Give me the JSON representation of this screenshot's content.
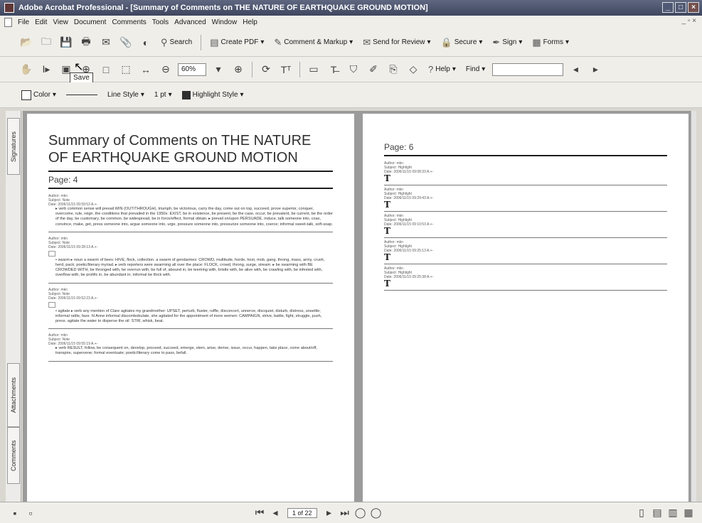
{
  "window": {
    "title": "Adobe Acrobat Professional - [Summary of Comments on THE NATURE OF EARTHQUAKE GROUND MOTION]",
    "minimize": "_",
    "maximize": "□",
    "close": "×"
  },
  "menu": {
    "items": [
      "File",
      "Edit",
      "View",
      "Document",
      "Comments",
      "Tools",
      "Advanced",
      "Window",
      "Help"
    ],
    "mdi_controls": "_ ▫ ×"
  },
  "toolbar1": {
    "search_label": "Search",
    "create_pdf_label": "Create PDF",
    "comment_markup_label": "Comment & Markup",
    "send_review_label": "Send for Review",
    "secure_label": "Secure",
    "sign_label": "Sign",
    "forms_label": "Forms"
  },
  "toolbar2": {
    "zoom_value": "60%",
    "help_label": "Help",
    "find_label": "Find",
    "tooltip": "Save"
  },
  "toolbar3": {
    "color_label": "Color",
    "line_style_label": "Line Style",
    "line_width": "1 pt",
    "highlight_style_label": "Highlight Style"
  },
  "nav_tabs": {
    "signatures": "Signatures",
    "attachments": "Attachments",
    "comments": "Comments"
  },
  "page_left": {
    "title": "Summary of Comments on THE NATURE OF EARTHQUAKE GROUND MOTION",
    "page_label": "Page: 4",
    "entries": [
      {
        "meta": [
          "Author: mkn",
          "Subject: Note",
          "Date: 2006/11/15 09:59:53 A.+-"
        ],
        "text": "▸ verb common sense will prevail WIN (OUT/THROUGH), triumph, be victorious, carry the day, come out on top, succeed, prove superior, conquer, overcome, rule, reign. the conditions that prevailed in the 1950s: EXIST, be in existence, be present, be the case, occur, be prevalent, be current, be the order of the day, be customary, be common, be widespread, be in force/effect, formal obtain. ▸ prevail on/upon PERSUADE, induce, talk someone into, coax, convince, make, get, press someone into, argue someone into, urge, pressure someone into, pressurize someone into, coerce; informal sweet-talk, soft-soap."
      },
      {
        "meta": [
          "Author: mkn",
          "Subject: Note",
          "Date: 2006/11/15 09:28:13 A.+-"
        ],
        "text": "• swarm ▸ noun a swarm of bees: HIVE, flock, collection. a swarm of gendarmes: CROWD, multitude, horde, host, mob, gang, throng, mass, army, crush, herd, pack; poetic/literary myriad. ▸ verb reporters were swarming all over the place: FLOCK, crowd, throng, surge, stream. ▸ be swarming with BE CROWDED WITH, be thronged with, be overrun with, be full of, abound in, be teeming with, bristle with, be alive with, be crawling with, be infested with, overflow with, be prolific in, be abundant in; informal be thick with."
      },
      {
        "meta": [
          "Author: mkn",
          "Subject: Note",
          "Date: 2006/11/15 09:52:23 A.+-"
        ],
        "text": "• agitate ▸ verb any mention of Clare agitates my grandmother: UPSET, perturb, fluster, ruffle, disconcert, unnerve, discquiet, disturb, distress, unsettle; informal rattle, faze. hl Anne informal discombobulate. she agitated for the appointment of more women: CAMPAIGN, strive, battle, fight, struggle, push, press. agitate the water to disperse the oil: STIR, whisk, beat."
      },
      {
        "meta": [
          "Author: mkn",
          "Subject: Note",
          "Date: 2006/11/15 09:55:19 A.+-"
        ],
        "text": "▸ verb RESULT, follow, be consequent on, develop, proceed, succeed, emerge, stem, arise, derive, issue, occur, happen, take place, come about/off, transpire, supervene; formal eventuate; poetic/literary come to pass, befall."
      }
    ]
  },
  "page_right": {
    "page_label": "Page: 6",
    "entries": [
      {
        "meta": [
          "Author: mkn",
          "Subject: Highlight",
          "Date: 2006/11/15 09:08:33 A.+-"
        ]
      },
      {
        "meta": [
          "Author: mkn",
          "Subject: Highlight",
          "Date: 2006/11/15 09:29:43 A.+-"
        ]
      },
      {
        "meta": [
          "Author: mkn",
          "Subject: Highlight",
          "Date: 2006/11/15 09:10:53 A.+-"
        ]
      },
      {
        "meta": [
          "Author: mkn",
          "Subject: Highlight",
          "Date: 2006/11/15 09:25:13 A.+-"
        ]
      },
      {
        "meta": [
          "Author: mkn",
          "Subject: Highlight",
          "Date: 2006/11/15 09:25:38 A.+-"
        ]
      }
    ],
    "highlight_glyph": "T"
  },
  "status": {
    "page_indicator": "1 of 22"
  }
}
